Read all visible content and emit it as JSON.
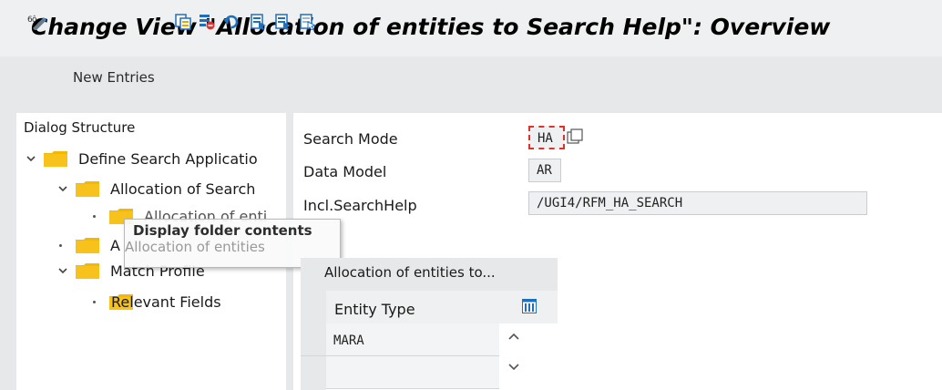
{
  "title": "Change View \"Allocation of entities to Search Help\": Overview",
  "toolbar": {
    "new_entries_label": "New Entries",
    "icons": [
      "display-change-icon",
      "copy-icon",
      "delete-icon",
      "undo-icon",
      "select-all-icon",
      "select-block-icon",
      "deselect-all-icon"
    ]
  },
  "dialog_structure": {
    "header": "Dialog Structure",
    "items": [
      {
        "label": "Define Search Applicatio",
        "level": 0,
        "expander": "expanded"
      },
      {
        "label": "Allocation of Search",
        "level": 1,
        "expander": "expanded"
      },
      {
        "label": "Allocation of enti",
        "level": 2,
        "expander": "leaf"
      },
      {
        "label": "A",
        "level": 0,
        "expander": "leaf"
      },
      {
        "label": "Match Profile",
        "level": 1,
        "expander": "expanded"
      },
      {
        "label": "Relevant Fields",
        "level": 2,
        "expander": "leaf"
      }
    ]
  },
  "tooltip": {
    "text": "Display folder contents",
    "ghost_text": "Allocation of entities"
  },
  "form": {
    "search_mode_label": "Search Mode",
    "search_mode_value": "HA",
    "data_model_label": "Data Model",
    "data_model_value": "AR",
    "incl_searchhelp_label": "Incl.SearchHelp",
    "incl_searchhelp_value": "/UGI4/RFM_HA_SEARCH"
  },
  "table": {
    "title": "Allocation of entities to...",
    "column_header": "Entity Type",
    "rows": [
      "MARA",
      ""
    ]
  },
  "colors": {
    "folder": "#f5b800",
    "focus": "#e0322b",
    "background": "#e6e8ea"
  }
}
